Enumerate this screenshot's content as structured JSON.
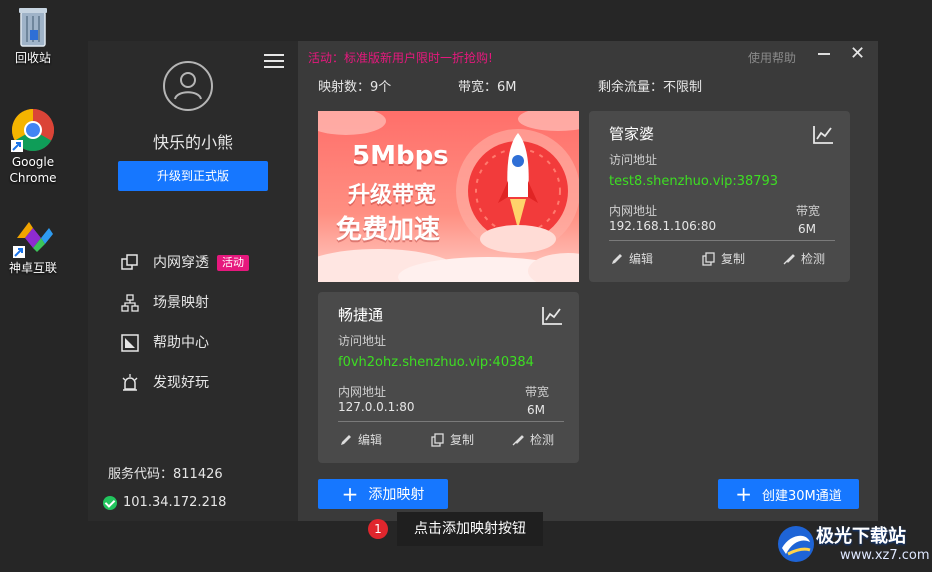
{
  "desktop": {
    "icons": [
      {
        "label": "回收站",
        "icon": "recycle-bin-icon"
      },
      {
        "label": "Google\nChrome",
        "icon": "chrome-icon"
      },
      {
        "label": "神卓互联",
        "icon": "shenzhuo-icon"
      }
    ]
  },
  "sidebar": {
    "username": "快乐的小熊",
    "upgrade_label": "升级到正式版",
    "nav": [
      {
        "label": "内网穿透",
        "icon": "tunnel-icon",
        "badge": "活动"
      },
      {
        "label": "场景映射",
        "icon": "network-icon"
      },
      {
        "label": "帮助中心",
        "icon": "help-center-icon"
      },
      {
        "label": "发现好玩",
        "icon": "discover-icon"
      }
    ],
    "service_code": "服务代码：811426",
    "ip": "101.34.172.218"
  },
  "header": {
    "promo": "活动：标准版新用户限时一折抢购!",
    "help": "使用帮助",
    "stats": {
      "mappings": "映射数：9个",
      "bandwidth": "带宽：6M",
      "traffic": "剩余流量：不限制"
    }
  },
  "banner": {
    "line1": "5Mbps",
    "line2": "升级带宽",
    "line3": "免费加速"
  },
  "cards": [
    {
      "title": "管家婆",
      "access_label": "访问地址",
      "url": "test8.shenzhuo.vip:38793",
      "intranet_label": "内网地址",
      "intranet": "192.168.1.106:80",
      "bw_label": "带宽",
      "bw": "6M",
      "edit": "编辑",
      "copy": "复制",
      "check": "检测"
    },
    {
      "title": "畅捷通",
      "access_label": "访问地址",
      "url": "f0vh2ohz.shenzhuo.vip:40384",
      "intranet_label": "内网地址",
      "intranet": "127.0.0.1:80",
      "bw_label": "带宽",
      "bw": "6M",
      "edit": "编辑",
      "copy": "复制",
      "check": "检测"
    }
  ],
  "actions": {
    "add_mapping": "添加映射",
    "create_channel": "创建30M通道"
  },
  "tooltip": {
    "number": "1",
    "text": "点击添加映射按钮"
  },
  "watermark": {
    "name": "极光下载站",
    "url": "www.xz7.com"
  },
  "colors": {
    "accent": "#1677ff",
    "url_green": "#3dde22",
    "promo_pink": "#e6187d"
  }
}
